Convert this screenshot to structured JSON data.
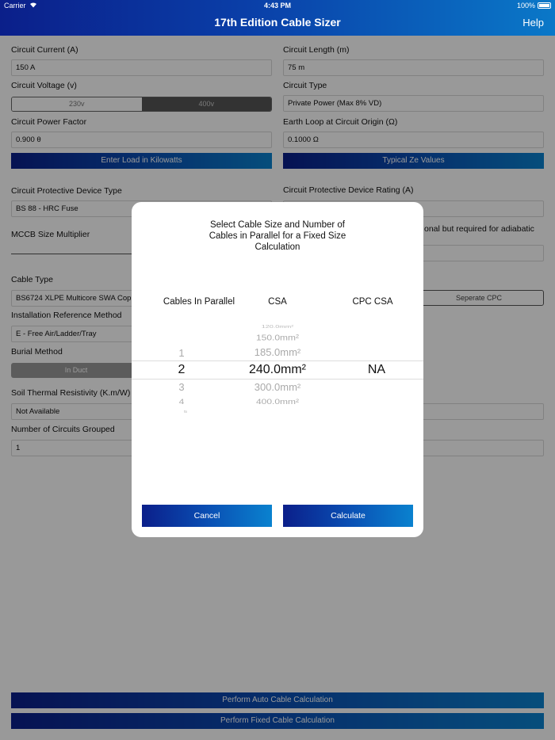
{
  "status_bar": {
    "carrier": "Carrier",
    "time": "4:43 PM",
    "battery": "100%"
  },
  "nav": {
    "title": "17th Edition Cable Sizer",
    "help": "Help"
  },
  "form": {
    "circuit_current": {
      "label": "Circuit Current (A)",
      "value": "150 A"
    },
    "circuit_length": {
      "label": "Circuit Length (m)",
      "value": "75 m"
    },
    "circuit_voltage": {
      "label": "Circuit Voltage (v)",
      "options": [
        "230v",
        "400v"
      ],
      "selected": "400v"
    },
    "circuit_type": {
      "label": "Circuit Type",
      "value": "Private Power (Max 8% VD)"
    },
    "power_factor": {
      "label": "Circuit Power Factor",
      "value": "0.900 θ"
    },
    "earth_loop": {
      "label": "Earth Loop at Circuit Origin (Ω)",
      "value": "0.1000 Ω"
    },
    "enter_load_button": "Enter Load in Kilowatts",
    "typical_ze_button": "Typical Ze Values",
    "protective_device_type": {
      "label": "Circuit Protective Device Type",
      "value": "BS 88 - HRC Fuse"
    },
    "protective_device_rating": {
      "label": "Circuit Protective Device Rating (A)"
    },
    "mccb_multiplier": {
      "label": "MCCB Size Multiplier"
    },
    "adiabatic_note": "onal but required for adiabatic",
    "cable_type": {
      "label": "Cable Type",
      "value": "BS6724 XLPE Multicore SWA Cop"
    },
    "separate_cpc_button": "Seperate CPC",
    "installation_method": {
      "label": "Installation Reference Method",
      "value": "E - Free Air/Ladder/Tray"
    },
    "burial_method": {
      "label": "Burial Method",
      "button": "In Duct"
    },
    "soil_resistivity": {
      "label": "Soil Thermal Resistivity (K.m/W)",
      "value": "Not Available"
    },
    "circuits_grouped": {
      "label": "Number of Circuits Grouped",
      "value": "1"
    }
  },
  "bottom_buttons": {
    "auto": "Perform Auto Cable Calculation",
    "fixed": "Perform Fixed Cable Calculation"
  },
  "modal": {
    "title_lines": [
      "Select Cable Size and Number of",
      "Cables in Parallel for a Fixed Size",
      "Calculation"
    ],
    "columns": [
      "Cables In Parallel",
      "CSA",
      "CPC CSA"
    ],
    "parallel_picker": {
      "above": [
        "1"
      ],
      "selected": "2",
      "below": [
        "3",
        "4",
        "5"
      ]
    },
    "csa_picker": {
      "above": [
        "120.0mm²",
        "150.0mm²",
        "185.0mm²"
      ],
      "selected": "240.0mm²",
      "below": [
        "300.0mm²",
        "400.0mm²"
      ]
    },
    "cpc_picker": {
      "selected": "NA"
    },
    "cancel_button": "Cancel",
    "calculate_button": "Calculate"
  }
}
